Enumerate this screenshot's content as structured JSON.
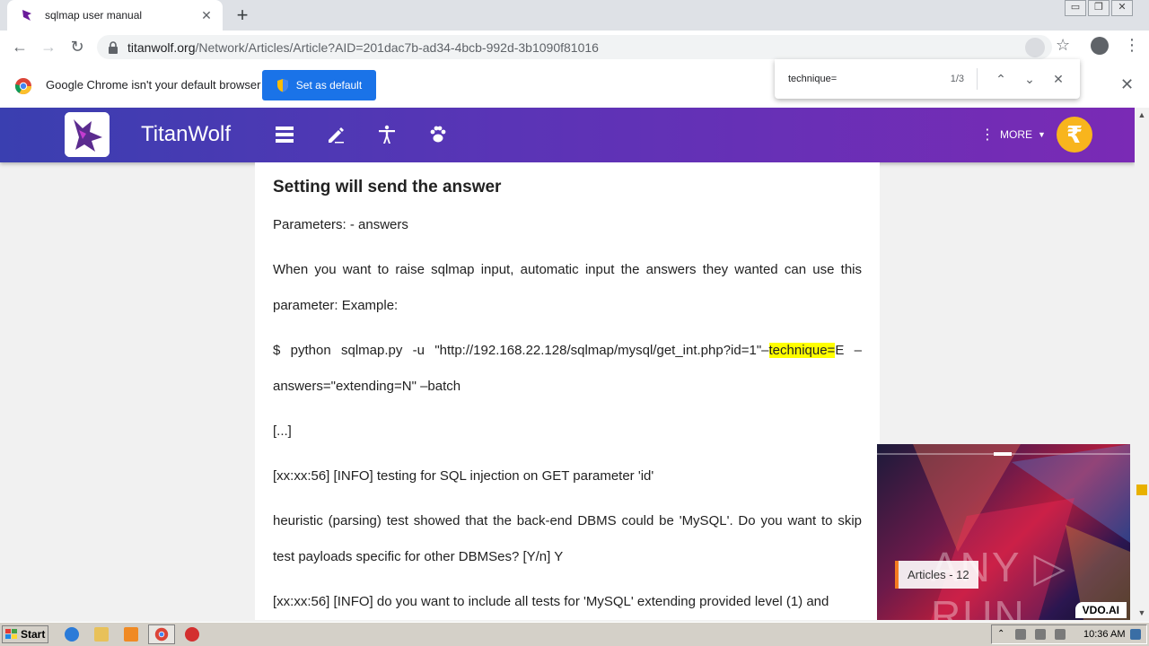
{
  "tab": {
    "title": "sqlmap user manual",
    "close": "✕",
    "new_tab": "+"
  },
  "window_controls": {
    "minimize": "▭",
    "restore": "❐",
    "close": "✕"
  },
  "address": {
    "host": "titanwolf.org",
    "path": "/Network/Articles/Article?AID=201dac7b-ad34-4bcb-992d-3b1090f81016"
  },
  "infobar": {
    "message": "Google Chrome isn't your default browser",
    "button": "Set as default",
    "close": "✕"
  },
  "findbar": {
    "query": "technique=",
    "count": "1/3",
    "prev": "⌃",
    "next": "⌄",
    "close": "✕"
  },
  "site": {
    "brand": "TitanWolf",
    "more": "MORE",
    "coin_symbol": "₹"
  },
  "article": {
    "heading": "Setting will send the answer",
    "p1": "Parameters: - answers",
    "p2": "When you want to raise sqlmap input, automatic input the answers they wanted can use this parameter: Example:",
    "p3_before": "$ python sqlmap.py -u \"http://192.168.22.128/sqlmap/mysql/get_int.php?id=1\"–",
    "p3_highlight": "technique=",
    "p3_after": "E –answers=\"extending=N\" –batch",
    "p4": "[...]",
    "p5": "[xx:xx:56] [INFO] testing for SQL injection on GET parameter 'id'",
    "p6": "heuristic (parsing) test showed that the back-end DBMS could be 'MySQL'. Do you want to skip test payloads specific for other DBMSes? [Y/n] Y",
    "p7": "[xx:xx:56] [INFO] do you want to include all tests for 'MySQL' extending provided level (1) and"
  },
  "ad": {
    "label": "Articles - 12",
    "watermark": "ANY ▷ RUN",
    "brand": "VDO.AI"
  },
  "taskbar": {
    "start": "Start",
    "clock": "10:36 AM"
  },
  "colors": {
    "accent": "#1a73e8",
    "header_start": "#3a3fb0",
    "header_end": "#7a2ab5",
    "highlight": "#ffff00"
  }
}
